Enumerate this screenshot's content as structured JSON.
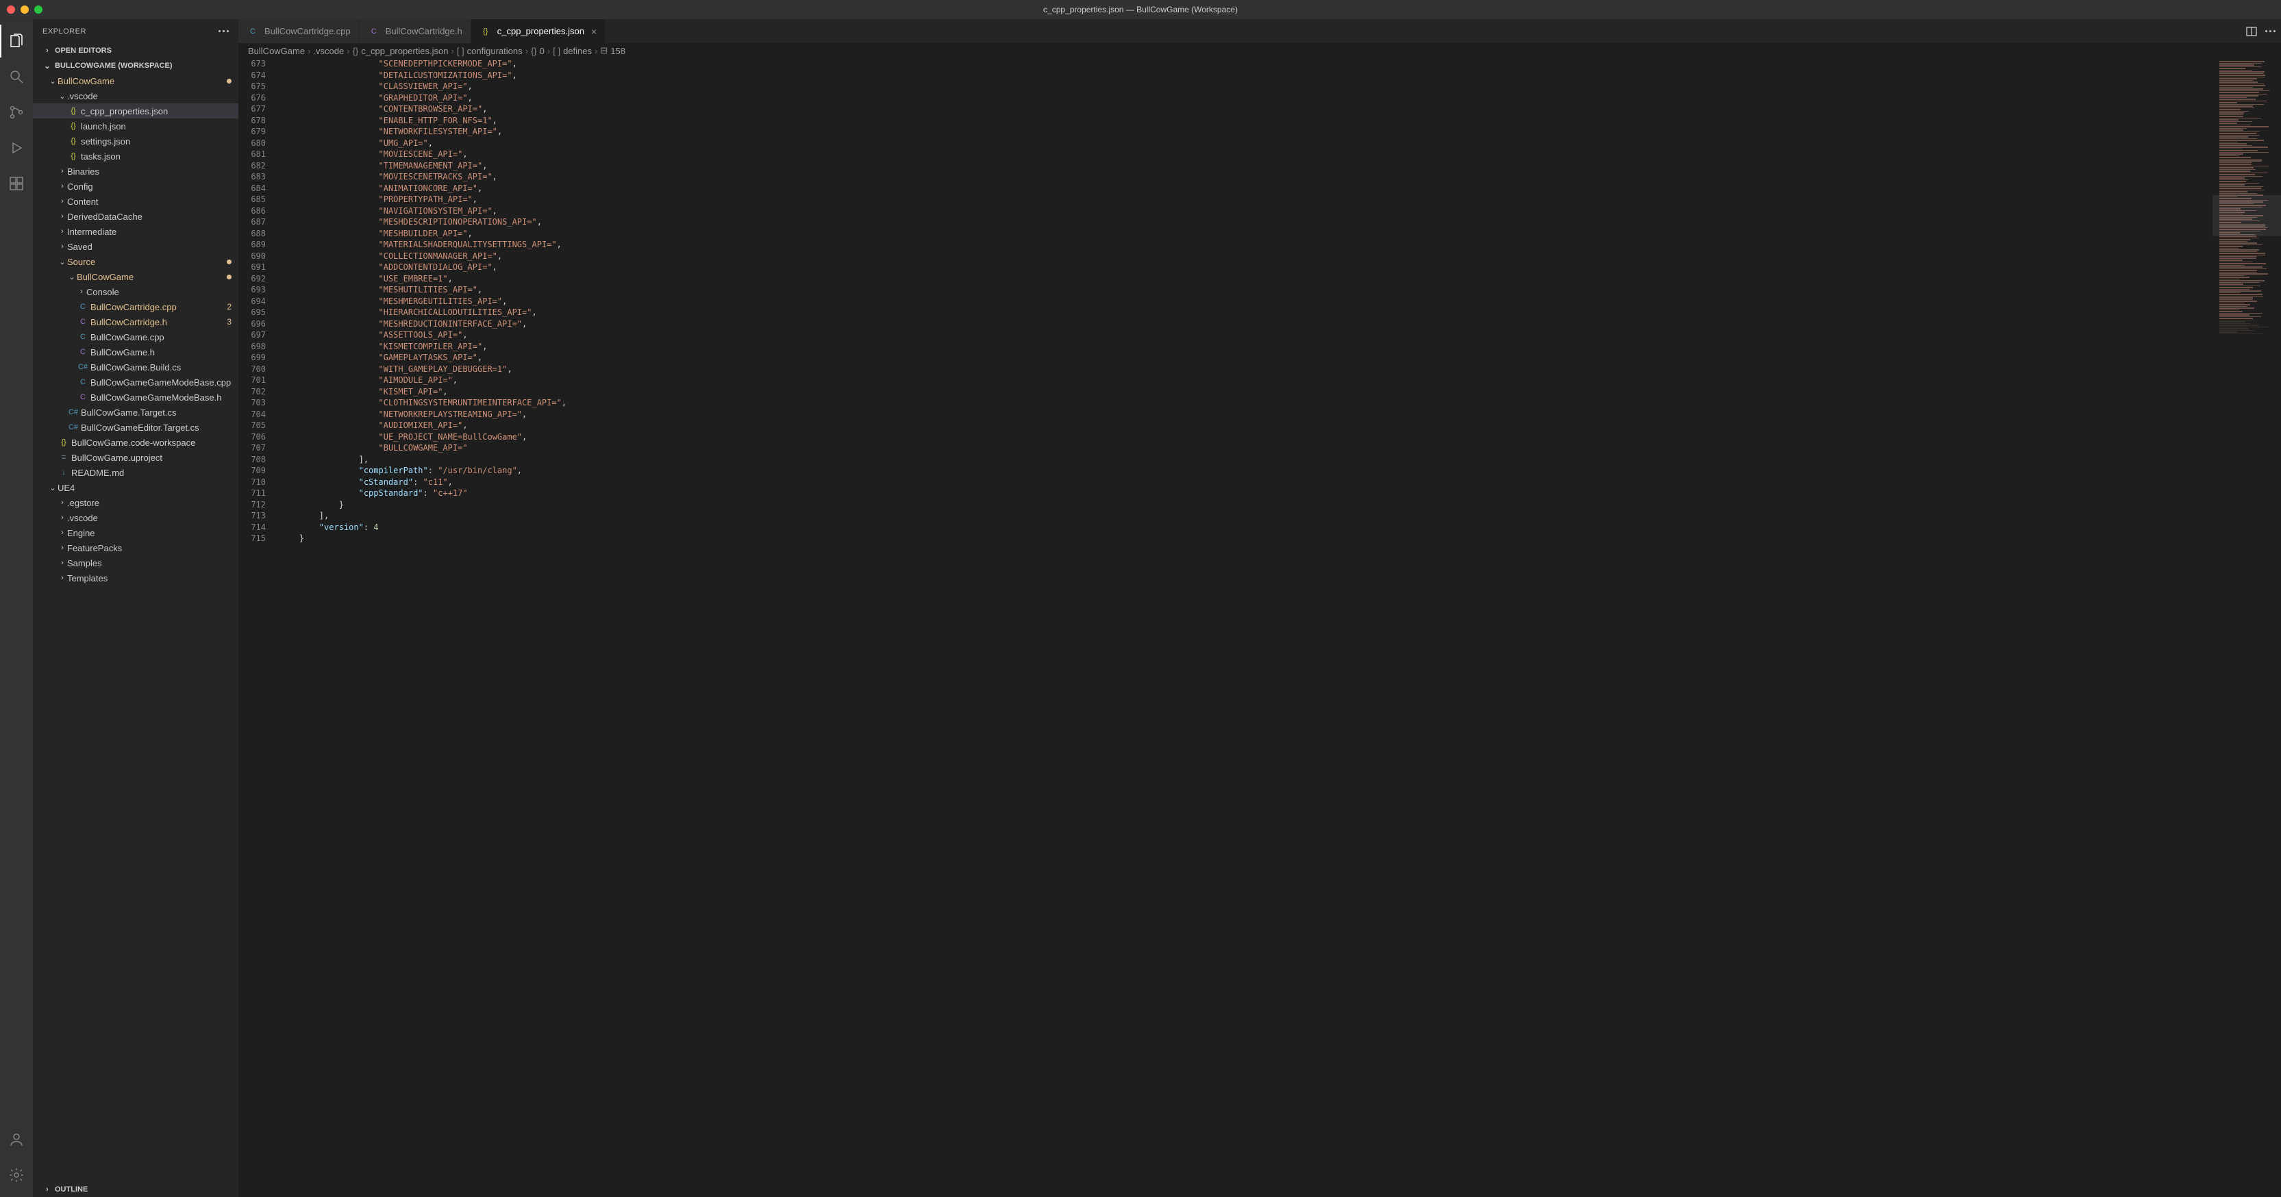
{
  "title": "c_cpp_properties.json — BullCowGame (Workspace)",
  "sidebar": {
    "title": "EXPLORER",
    "openEditors": "OPEN EDITORS",
    "workspace": "BULLCOWGAME (WORKSPACE)",
    "outline": "OUTLINE",
    "tree": [
      {
        "depth": 1,
        "chev": "down",
        "label": "BullCowGame",
        "modified": true,
        "dot": true
      },
      {
        "depth": 2,
        "chev": "down",
        "label": ".vscode"
      },
      {
        "depth": 3,
        "icon": "json",
        "label": "c_cpp_properties.json",
        "selected": true
      },
      {
        "depth": 3,
        "icon": "json",
        "label": "launch.json"
      },
      {
        "depth": 3,
        "icon": "json",
        "label": "settings.json"
      },
      {
        "depth": 3,
        "icon": "json",
        "label": "tasks.json"
      },
      {
        "depth": 2,
        "chev": "right",
        "label": "Binaries"
      },
      {
        "depth": 2,
        "chev": "right",
        "label": "Config"
      },
      {
        "depth": 2,
        "chev": "right",
        "label": "Content"
      },
      {
        "depth": 2,
        "chev": "right",
        "label": "DerivedDataCache"
      },
      {
        "depth": 2,
        "chev": "right",
        "label": "Intermediate"
      },
      {
        "depth": 2,
        "chev": "right",
        "label": "Saved"
      },
      {
        "depth": 2,
        "chev": "down",
        "label": "Source",
        "modified": true,
        "dot": true
      },
      {
        "depth": 3,
        "chev": "down",
        "label": "BullCowGame",
        "modified": true,
        "dot": true
      },
      {
        "depth": 4,
        "chev": "right",
        "label": "Console"
      },
      {
        "depth": 4,
        "icon": "cpp",
        "label": "BullCowCartridge.cpp",
        "modified": true,
        "badge": "2"
      },
      {
        "depth": 4,
        "icon": "h",
        "label": "BullCowCartridge.h",
        "modified": true,
        "badge": "3"
      },
      {
        "depth": 4,
        "icon": "cpp",
        "label": "BullCowGame.cpp"
      },
      {
        "depth": 4,
        "icon": "h",
        "label": "BullCowGame.h"
      },
      {
        "depth": 4,
        "icon": "cs",
        "label": "BullCowGame.Build.cs"
      },
      {
        "depth": 4,
        "icon": "cpp",
        "label": "BullCowGameGameModeBase.cpp"
      },
      {
        "depth": 4,
        "icon": "h",
        "label": "BullCowGameGameModeBase.h"
      },
      {
        "depth": 3,
        "icon": "cs",
        "label": "BullCowGame.Target.cs"
      },
      {
        "depth": 3,
        "icon": "cs",
        "label": "BullCowGameEditor.Target.cs"
      },
      {
        "depth": 2,
        "icon": "ws",
        "label": "BullCowGame.code-workspace"
      },
      {
        "depth": 2,
        "icon": "txt",
        "label": "BullCowGame.uproject"
      },
      {
        "depth": 2,
        "icon": "md",
        "label": "README.md"
      },
      {
        "depth": 1,
        "chev": "down",
        "label": "UE4"
      },
      {
        "depth": 2,
        "chev": "right",
        "label": ".egstore"
      },
      {
        "depth": 2,
        "chev": "right",
        "label": ".vscode"
      },
      {
        "depth": 2,
        "chev": "right",
        "label": "Engine"
      },
      {
        "depth": 2,
        "chev": "right",
        "label": "FeaturePacks"
      },
      {
        "depth": 2,
        "chev": "right",
        "label": "Samples"
      },
      {
        "depth": 2,
        "chev": "right",
        "label": "Templates"
      }
    ]
  },
  "tabs": [
    {
      "icon": "cpp",
      "label": "BullCowCartridge.cpp"
    },
    {
      "icon": "h",
      "label": "BullCowCartridge.h"
    },
    {
      "icon": "json",
      "label": "c_cpp_properties.json",
      "active": true,
      "close": true
    }
  ],
  "breadcrumbs": [
    {
      "label": "BullCowGame"
    },
    {
      "label": ".vscode"
    },
    {
      "icon": "json",
      "label": "c_cpp_properties.json"
    },
    {
      "icon": "array",
      "label": "configurations"
    },
    {
      "icon": "obj",
      "label": "0"
    },
    {
      "icon": "array",
      "label": "defines"
    },
    {
      "icon": "str",
      "label": "158"
    }
  ],
  "code": {
    "start": 673,
    "lines": [
      {
        "n": 673,
        "indent": 5,
        "type": "str",
        "text": "\"SCENEDEPTHPICKERMODE_API=\"",
        "trail": ","
      },
      {
        "n": 674,
        "indent": 5,
        "type": "str",
        "text": "\"DETAILCUSTOMIZATIONS_API=\"",
        "trail": ","
      },
      {
        "n": 675,
        "indent": 5,
        "type": "str",
        "text": "\"CLASSVIEWER_API=\"",
        "trail": ","
      },
      {
        "n": 676,
        "indent": 5,
        "type": "str",
        "text": "\"GRAPHEDITOR_API=\"",
        "trail": ","
      },
      {
        "n": 677,
        "indent": 5,
        "type": "str",
        "text": "\"CONTENTBROWSER_API=\"",
        "trail": ","
      },
      {
        "n": 678,
        "indent": 5,
        "type": "str",
        "text": "\"ENABLE_HTTP_FOR_NFS=1\"",
        "trail": ","
      },
      {
        "n": 679,
        "indent": 5,
        "type": "str",
        "text": "\"NETWORKFILESYSTEM_API=\"",
        "trail": ","
      },
      {
        "n": 680,
        "indent": 5,
        "type": "str",
        "text": "\"UMG_API=\"",
        "trail": ","
      },
      {
        "n": 681,
        "indent": 5,
        "type": "str",
        "text": "\"MOVIESCENE_API=\"",
        "trail": ","
      },
      {
        "n": 682,
        "indent": 5,
        "type": "str",
        "text": "\"TIMEMANAGEMENT_API=\"",
        "trail": ","
      },
      {
        "n": 683,
        "indent": 5,
        "type": "str",
        "text": "\"MOVIESCENETRACKS_API=\"",
        "trail": ","
      },
      {
        "n": 684,
        "indent": 5,
        "type": "str",
        "text": "\"ANIMATIONCORE_API=\"",
        "trail": ","
      },
      {
        "n": 685,
        "indent": 5,
        "type": "str",
        "text": "\"PROPERTYPATH_API=\"",
        "trail": ","
      },
      {
        "n": 686,
        "indent": 5,
        "type": "str",
        "text": "\"NAVIGATIONSYSTEM_API=\"",
        "trail": ","
      },
      {
        "n": 687,
        "indent": 5,
        "type": "str",
        "text": "\"MESHDESCRIPTIONOPERATIONS_API=\"",
        "trail": ","
      },
      {
        "n": 688,
        "indent": 5,
        "type": "str",
        "text": "\"MESHBUILDER_API=\"",
        "trail": ","
      },
      {
        "n": 689,
        "indent": 5,
        "type": "str",
        "text": "\"MATERIALSHADERQUALITYSETTINGS_API=\"",
        "trail": ","
      },
      {
        "n": 690,
        "indent": 5,
        "type": "str",
        "text": "\"COLLECTIONMANAGER_API=\"",
        "trail": ","
      },
      {
        "n": 691,
        "indent": 5,
        "type": "str",
        "text": "\"ADDCONTENTDIALOG_API=\"",
        "trail": ","
      },
      {
        "n": 692,
        "indent": 5,
        "type": "str",
        "text": "\"USE_EMBREE=1\"",
        "trail": ","
      },
      {
        "n": 693,
        "indent": 5,
        "type": "str",
        "text": "\"MESHUTILITIES_API=\"",
        "trail": ","
      },
      {
        "n": 694,
        "indent": 5,
        "type": "str",
        "text": "\"MESHMERGEUTILITIES_API=\"",
        "trail": ","
      },
      {
        "n": 695,
        "indent": 5,
        "type": "str",
        "text": "\"HIERARCHICALLODUTILITIES_API=\"",
        "trail": ","
      },
      {
        "n": 696,
        "indent": 5,
        "type": "str",
        "text": "\"MESHREDUCTIONINTERFACE_API=\"",
        "trail": ","
      },
      {
        "n": 697,
        "indent": 5,
        "type": "str",
        "text": "\"ASSETTOOLS_API=\"",
        "trail": ","
      },
      {
        "n": 698,
        "indent": 5,
        "type": "str",
        "text": "\"KISMETCOMPILER_API=\"",
        "trail": ","
      },
      {
        "n": 699,
        "indent": 5,
        "type": "str",
        "text": "\"GAMEPLAYTASKS_API=\"",
        "trail": ","
      },
      {
        "n": 700,
        "indent": 5,
        "type": "str",
        "text": "\"WITH_GAMEPLAY_DEBUGGER=1\"",
        "trail": ","
      },
      {
        "n": 701,
        "indent": 5,
        "type": "str",
        "text": "\"AIMODULE_API=\"",
        "trail": ","
      },
      {
        "n": 702,
        "indent": 5,
        "type": "str",
        "text": "\"KISMET_API=\"",
        "trail": ","
      },
      {
        "n": 703,
        "indent": 5,
        "type": "str",
        "text": "\"CLOTHINGSYSTEMRUNTIMEINTERFACE_API=\"",
        "trail": ","
      },
      {
        "n": 704,
        "indent": 5,
        "type": "str",
        "text": "\"NETWORKREPLAYSTREAMING_API=\"",
        "trail": ","
      },
      {
        "n": 705,
        "indent": 5,
        "type": "str",
        "text": "\"AUDIOMIXER_API=\"",
        "trail": ","
      },
      {
        "n": 706,
        "indent": 5,
        "type": "str",
        "text": "\"UE_PROJECT_NAME=BullCowGame\"",
        "trail": ","
      },
      {
        "n": 707,
        "indent": 5,
        "type": "str",
        "text": "\"BULLCOWGAME_API=\"",
        "trail": ""
      },
      {
        "n": 708,
        "indent": 4,
        "type": "punc",
        "text": "],",
        "trail": ""
      },
      {
        "n": 709,
        "indent": 4,
        "type": "kv",
        "key": "\"compilerPath\"",
        "val": "\"/usr/bin/clang\"",
        "trail": ","
      },
      {
        "n": 710,
        "indent": 4,
        "type": "kv",
        "key": "\"cStandard\"",
        "val": "\"c11\"",
        "trail": ","
      },
      {
        "n": 711,
        "indent": 4,
        "type": "kv",
        "key": "\"cppStandard\"",
        "val": "\"c++17\"",
        "trail": ""
      },
      {
        "n": 712,
        "indent": 3,
        "type": "punc",
        "text": "}",
        "trail": ""
      },
      {
        "n": 713,
        "indent": 2,
        "type": "punc",
        "text": "],",
        "trail": ""
      },
      {
        "n": 714,
        "indent": 2,
        "type": "kvn",
        "key": "\"version\"",
        "num": "4",
        "trail": ""
      },
      {
        "n": 715,
        "indent": 1,
        "type": "punc",
        "text": "}",
        "trail": ""
      }
    ]
  }
}
